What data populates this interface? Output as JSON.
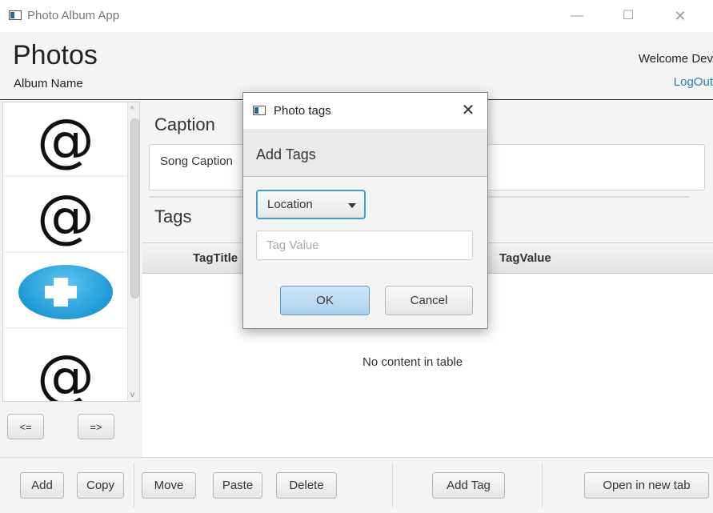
{
  "window": {
    "title": "Photo Album App",
    "minimize": "—",
    "maximize": "☐",
    "close": "✕"
  },
  "header": {
    "title": "Photos",
    "subtitle": "Album Name",
    "welcome": "Welcome Dev",
    "logout": "LogOut"
  },
  "thumbnails": {
    "items": [
      {
        "kind": "at-sign",
        "glyph": "@"
      },
      {
        "kind": "at-sign",
        "glyph": "@"
      },
      {
        "kind": "plus-image"
      },
      {
        "kind": "at-sign",
        "glyph": "@"
      }
    ]
  },
  "nav": {
    "prev_label": "<=",
    "next_label": "=>"
  },
  "main": {
    "caption_label": "Caption",
    "caption_value": "Song Caption",
    "tags_label": "Tags",
    "table": {
      "columns": [
        "TagTitle",
        "TagValue"
      ],
      "empty_message": "No content in table"
    }
  },
  "toolbar": {
    "add": "Add",
    "copy": "Copy",
    "move": "Move",
    "paste": "Paste",
    "delete": "Delete",
    "add_tag": "Add Tag",
    "open_new_tab": "Open in new tab"
  },
  "dialog": {
    "title": "Photo tags",
    "close": "✕",
    "header": "Add Tags",
    "select_value": "Location",
    "input_placeholder": "Tag Value",
    "ok": "OK",
    "cancel": "Cancel"
  },
  "colors": {
    "link": "#1f7fc4",
    "focus": "#3c9fe0",
    "default_button": "#a9d2ef"
  }
}
